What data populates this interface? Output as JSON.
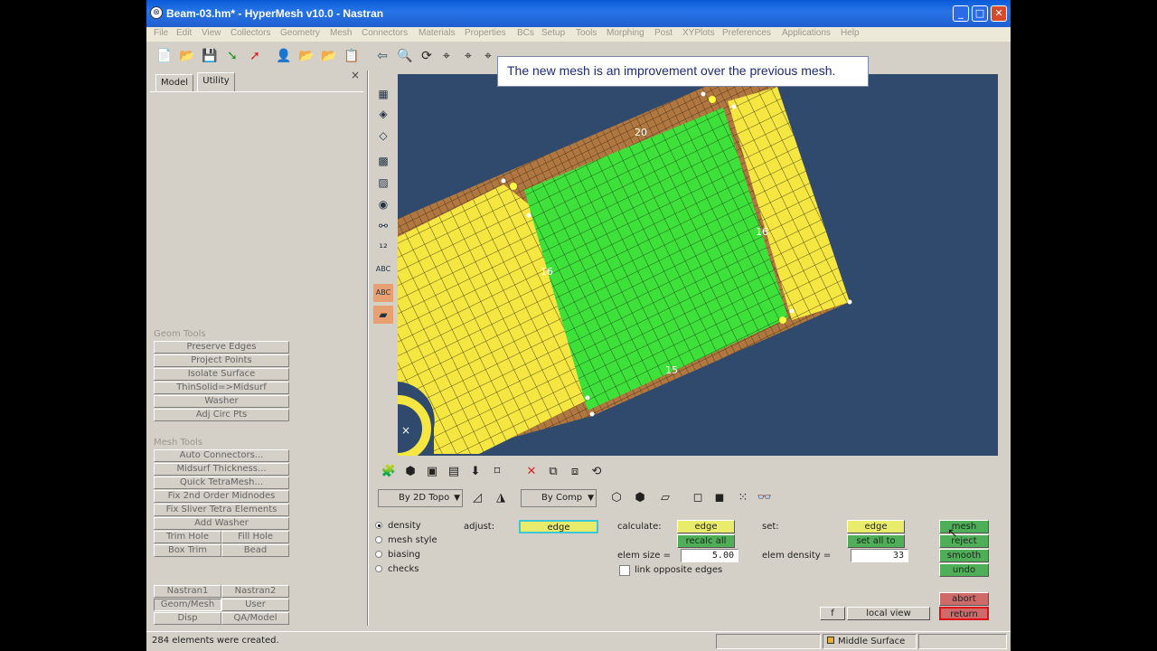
{
  "window": {
    "title": "Beam-03.hm* - HyperMesh v10.0 - Nastran"
  },
  "menu": [
    "File",
    "Edit",
    "View",
    "Collectors",
    "Geometry",
    "Mesh",
    "Connectors",
    "Materials",
    "Properties",
    "BCs",
    "Setup",
    "Tools",
    "Morphing",
    "Post",
    "XYPlots",
    "Preferences",
    "Applications",
    "Help"
  ],
  "tabs": {
    "model": "Model",
    "utility": "Utility",
    "close": "×"
  },
  "geom_tools": {
    "header": "Geom Tools",
    "buttons": [
      "Preserve Edges",
      "Project Points",
      "Isolate Surface",
      "ThinSolid=>Midsurf",
      "Washer",
      "Adj Circ Pts"
    ]
  },
  "mesh_tools": {
    "header": "Mesh Tools",
    "buttons": [
      "Auto Connectors...",
      "Midsurf Thickness...",
      "Quick TetraMesh...",
      "Fix 2nd Order Midnodes",
      "Fix Sliver Tetra Elements",
      "Add Washer"
    ],
    "pair1": [
      "Trim Hole",
      "Fill Hole"
    ],
    "pair2": [
      "Box Trim",
      "Bead"
    ]
  },
  "pages": {
    "row1": [
      "Nastran1",
      "Nastran2"
    ],
    "row2": [
      "Geom/Mesh",
      "User"
    ],
    "row3": [
      "Disp",
      "QA/Model"
    ]
  },
  "message": "The new mesh is an improvement over the previous mesh.",
  "viewport": {
    "labels": [
      "20",
      "15",
      "16",
      "16"
    ]
  },
  "display": {
    "topo_combo": "By 2D Topo",
    "comp_combo": "By Comp"
  },
  "radios": [
    {
      "label": "density",
      "checked": true
    },
    {
      "label": "mesh style",
      "checked": false
    },
    {
      "label": "biasing",
      "checked": false
    },
    {
      "label": "checks",
      "checked": false
    }
  ],
  "panel": {
    "adjust_label": "adjust:",
    "adjust_btn": "edge",
    "calculate_label": "calculate:",
    "calc_edge": "edge",
    "recalc_all": "recalc all",
    "elem_size_label": "elem size =",
    "elem_size": "5.00",
    "link_label": "link opposite edges",
    "set_label": "set:",
    "set_edge": "edge",
    "set_all_to": "set all to",
    "elem_density_label": "elem density =",
    "elem_density": "33",
    "mesh": "mesh",
    "reject": "reject",
    "smooth": "smooth",
    "undo": "undo",
    "abort": "abort",
    "return": "return",
    "f": "f",
    "local_view": "local view"
  },
  "status": {
    "message": "284 elements were created.",
    "component": "Middle Surface"
  },
  "colors": {
    "mesh_yellow": "#f5e642",
    "mesh_green": "#3ee03a",
    "background": "#2f4a6c",
    "edge_brown": "#b07840"
  }
}
